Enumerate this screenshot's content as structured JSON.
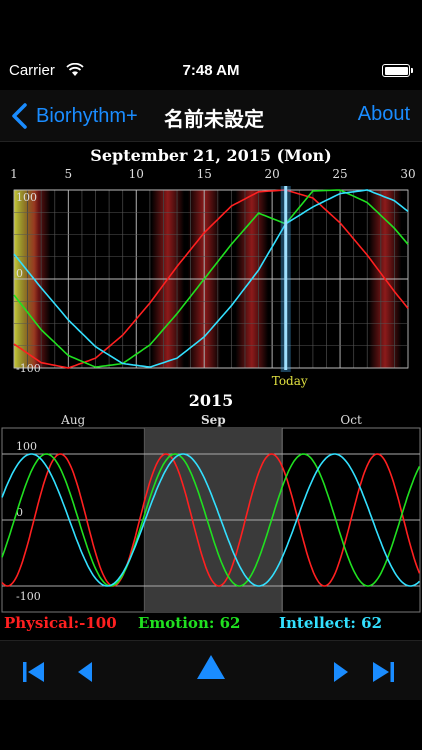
{
  "status_bar": {
    "carrier": "Carrier",
    "time": "7:48 AM"
  },
  "nav": {
    "back_label": "Biorhythm+",
    "title": "名前未設定",
    "about_label": "About"
  },
  "date_title": "September 21, 2015 (Mon)",
  "year_title": "2015",
  "colors": {
    "physical": "#ff2020",
    "emotion": "#20e020",
    "intellect": "#33e0ff",
    "accent": "#1a8cff"
  },
  "values": {
    "physical": "Physical:-100",
    "emotion": "Emotion: 62",
    "intellect": "Intellect: 62"
  },
  "today_label": "Today",
  "chart_data": [
    {
      "type": "line",
      "title": "September 21, 2015 (Mon)",
      "x_tick_labels": [
        "1",
        "5",
        "10",
        "15",
        "20",
        "25",
        "30"
      ],
      "x_ticks": [
        1,
        5,
        10,
        15,
        20,
        25,
        30
      ],
      "y_tick_labels": [
        "100",
        "0",
        "-100"
      ],
      "y_ticks": [
        100,
        0,
        -100
      ],
      "xlim": [
        1,
        30
      ],
      "ylim": [
        -100,
        100
      ],
      "highlight_day": 21,
      "grid": true,
      "series": [
        {
          "color": "#ff2020",
          "period": 23,
          "x": [
            1,
            3,
            5,
            7,
            9,
            11,
            13,
            15,
            17,
            19,
            21,
            23,
            25,
            27,
            29,
            30
          ],
          "y": [
            -73,
            -94,
            -100,
            -89,
            -63,
            -27,
            14,
            52,
            82,
            98,
            100,
            91,
            63,
            27,
            -14,
            -33
          ]
        },
        {
          "color": "#20e020",
          "period": 28,
          "x": [
            1,
            3,
            5,
            7,
            9,
            11,
            13,
            15,
            17,
            19,
            21,
            23,
            25,
            27,
            29,
            30
          ],
          "y": [
            -18,
            -57,
            -86,
            -99,
            -95,
            -74,
            -39,
            0,
            39,
            74,
            62,
            99,
            100,
            86,
            57,
            39
          ]
        },
        {
          "color": "#33e0ff",
          "period": 33,
          "x": [
            1,
            3,
            5,
            7,
            9,
            11,
            13,
            15,
            17,
            19,
            21,
            23,
            25,
            27,
            29,
            30
          ],
          "y": [
            28,
            -10,
            -46,
            -76,
            -95,
            -99,
            -89,
            -65,
            -30,
            10,
            62,
            81,
            96,
            100,
            88,
            76
          ]
        }
      ]
    },
    {
      "type": "line",
      "title": "2015",
      "x_tick_labels": [
        "Aug",
        "Sep",
        "Oct"
      ],
      "y_tick_labels": [
        "100",
        "0",
        "-100"
      ],
      "y_ticks": [
        100,
        0,
        -100
      ],
      "ylim": [
        -100,
        100
      ],
      "xlim": [
        1,
        92
      ],
      "highlight_month": "Sep",
      "series": [
        {
          "color": "#ff2020",
          "period": 23,
          "phase_day": 1
        },
        {
          "color": "#20e020",
          "period": 28,
          "phase_day": 1
        },
        {
          "color": "#33e0ff",
          "period": 33,
          "phase_day": 1
        }
      ]
    }
  ],
  "toolbar": {
    "first": "first-icon",
    "prev": "prev-icon",
    "today": "today-icon",
    "next": "next-icon",
    "last": "last-icon"
  }
}
